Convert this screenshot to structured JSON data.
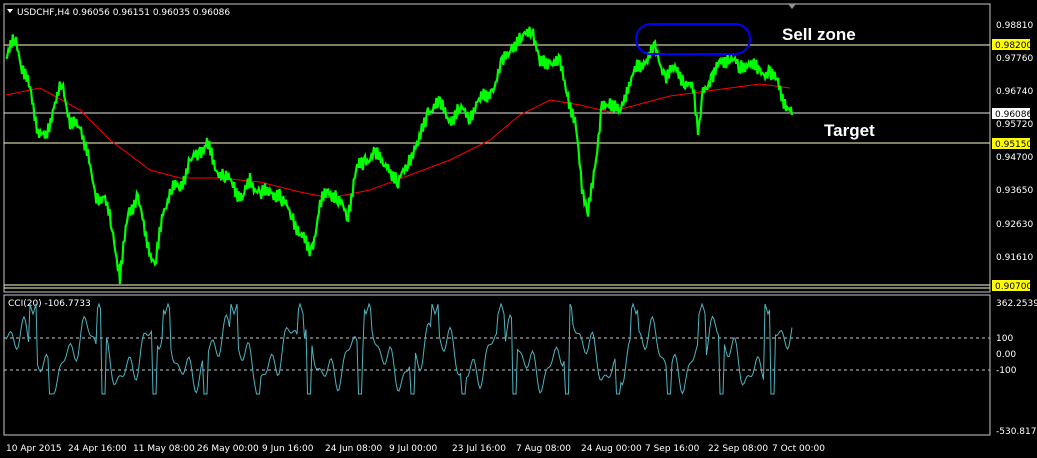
{
  "header": {
    "symbol_info": "USDCHF,H4  0.96056 0.96151 0.96035 0.96086",
    "dropdown_icon": "triangle-down-icon"
  },
  "indicator": {
    "label": "CCI(20) -106.7733",
    "levels": [
      "100",
      "0.00",
      "-100"
    ],
    "scale_top": "362.2539",
    "scale_bottom": "-530.8174",
    "color": "#4fb3bf"
  },
  "price_axis": {
    "labels": [
      "0.98810",
      "0.97760",
      "0.96740",
      "0.95720",
      "0.94700",
      "0.93650",
      "0.92630",
      "0.91610"
    ],
    "tags": [
      {
        "text": "0.98200",
        "style": "yellow"
      },
      {
        "text": "0.96086",
        "style": "white"
      },
      {
        "text": "0.95150",
        "style": "yellow"
      },
      {
        "text": "0.90700",
        "style": "yellow"
      }
    ]
  },
  "time_axis": {
    "labels": [
      "10 Apr 2015",
      "24 Apr 16:00",
      "11 May 08:00",
      "26 May 00:00",
      "9 Jun 16:00",
      "24 Jun 08:00",
      "9 Jul 00:00",
      "23 Jul 16:00",
      "7 Aug 08:00",
      "24 Aug 00:00",
      "7 Sep 16:00",
      "22 Sep 08:00",
      "7 Oct 00:00"
    ]
  },
  "annotations": {
    "sell_zone": "Sell zone",
    "target": "Target"
  },
  "colors": {
    "price": "#00ff00",
    "ma": "#ff0000",
    "zone_ellipse": "#0000ff",
    "level_line": "#ffffbf"
  }
}
